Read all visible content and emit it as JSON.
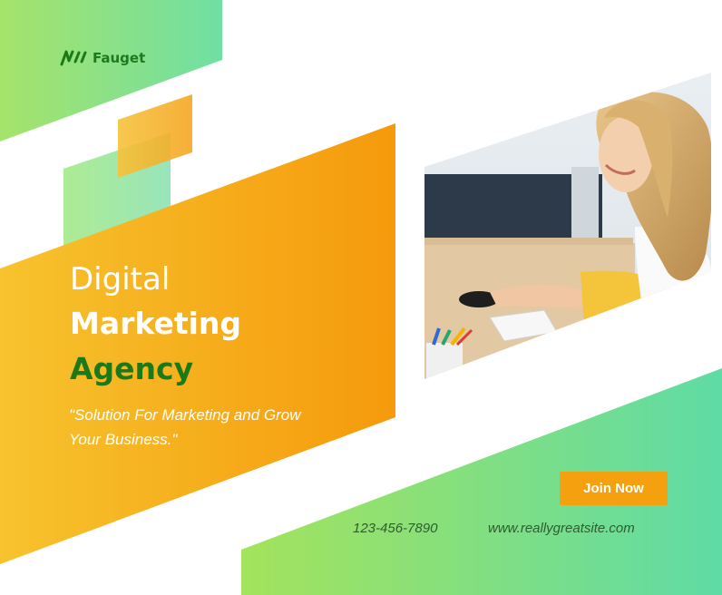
{
  "brand": {
    "name": "Fauget",
    "logo_icon": "wave-lines-icon",
    "color_green": "#1b7a17",
    "color_orange": "#f5a00f",
    "color_light_green": "#7ee08a"
  },
  "headline": {
    "line1": "Digital",
    "line2": "Marketing",
    "line3": "Agency"
  },
  "tagline": "\"Solution For Marketing and Grow Your Business.\"",
  "cta": {
    "label": "Join Now"
  },
  "contact": {
    "phone": "123-456-7890",
    "website": "www.reallygreatsite.com"
  },
  "photo": {
    "subject": "photo-woman-at-computer"
  }
}
